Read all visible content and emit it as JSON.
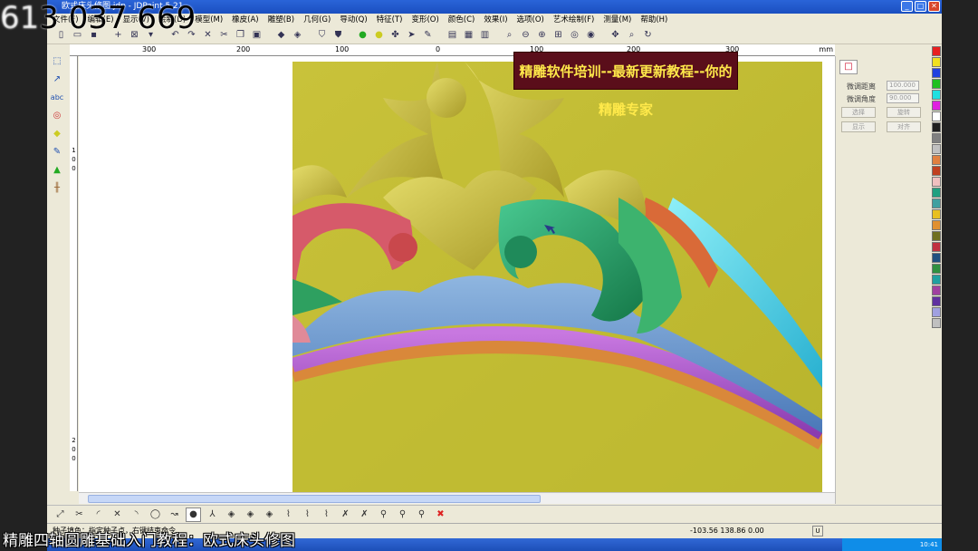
{
  "overlay": {
    "phone_faint": "61",
    "phone": "3 037 669",
    "subtitle": "精雕四轴圆雕基础入门教程：欧式床头修图"
  },
  "window": {
    "title": "欧式床头修图.jdp - JDPaint 5.21",
    "buttons": [
      "_",
      "□",
      "✕"
    ]
  },
  "menu": [
    {
      "label": "文件(F)"
    },
    {
      "label": "编辑(E)"
    },
    {
      "label": "显示(V)"
    },
    {
      "label": "绘制(D)"
    },
    {
      "label": "模型(M)"
    },
    {
      "label": "橡皮(A)"
    },
    {
      "label": "雕塑(B)"
    },
    {
      "label": "几何(G)"
    },
    {
      "label": "导动(Q)"
    },
    {
      "label": "特征(T)"
    },
    {
      "label": "变形(O)"
    },
    {
      "label": "颜色(C)"
    },
    {
      "label": "效果(I)"
    },
    {
      "label": "选项(O)"
    },
    {
      "label": "艺术绘制(F)"
    },
    {
      "label": "测量(M)"
    },
    {
      "label": "帮助(H)"
    }
  ],
  "ruler": {
    "top_ticks": [
      "300",
      "200",
      "100",
      "0",
      "100",
      "200",
      "300"
    ],
    "unit": "mm",
    "left_ticks": [
      "1",
      "0",
      "0",
      "2",
      "0",
      "0"
    ]
  },
  "banner": "精雕软件培训--最新更新教程--你的精雕专家",
  "right_panel": {
    "tab_icon": "□",
    "field1_label": "微调距离",
    "field1_value": "100.000",
    "field2_label": "微调角度",
    "field2_value": "90.000",
    "btn_select": "选择",
    "btn_rotate": "旋转",
    "btn_show": "显示",
    "btn_align": "对齐"
  },
  "palette": [
    "#e82020",
    "#f0e020",
    "#2040e0",
    "#20c020",
    "#20e0e0",
    "#e020e0",
    "#ffffff",
    "#202020",
    "#808080",
    "#c0c0c0",
    "#e08040",
    "#c04020",
    "#f0c0c0",
    "#20a080",
    "#40a0a0",
    "#e8c020",
    "#e09030",
    "#707020",
    "#c03040",
    "#205080",
    "#309040",
    "#20a0a0",
    "#a040a0",
    "#6030a0",
    "#a0a0e0",
    "#c0c0c0"
  ],
  "status": {
    "left": "种子填色：指定种子点，右键结束命令",
    "coords": "-103.56  138.86  0.00",
    "u": "U"
  },
  "tray_time": "10:41"
}
